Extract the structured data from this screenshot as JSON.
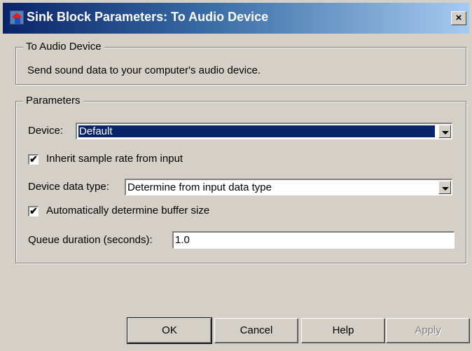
{
  "window": {
    "title": "Sink Block Parameters: To Audio Device",
    "close_label": "×"
  },
  "description_group": {
    "legend": "To Audio Device",
    "text": "Send sound data to your computer's audio device."
  },
  "parameters_group": {
    "legend": "Parameters",
    "device_label": "Device:",
    "device_value": "Default",
    "inherit_label": "Inherit sample rate from input",
    "inherit_checked": true,
    "datatype_label": "Device data type:",
    "datatype_value": "Determine from input data type",
    "buffer_label": "Automatically determine buffer size",
    "buffer_checked": true,
    "queue_label": "Queue duration (seconds):",
    "queue_value": "1.0"
  },
  "check_mark": "✔",
  "buttons": {
    "ok": "OK",
    "cancel": "Cancel",
    "help": "Help",
    "apply": "Apply"
  },
  "colors": {
    "titlebar_start": "#0a246a",
    "titlebar_end": "#a6caf0",
    "window_bg": "#d4d0c8",
    "selection": "#0a246a"
  },
  "icons": {
    "app": "simulink-block-icon",
    "close": "close-icon",
    "dropdown": "chevron-down-icon"
  }
}
